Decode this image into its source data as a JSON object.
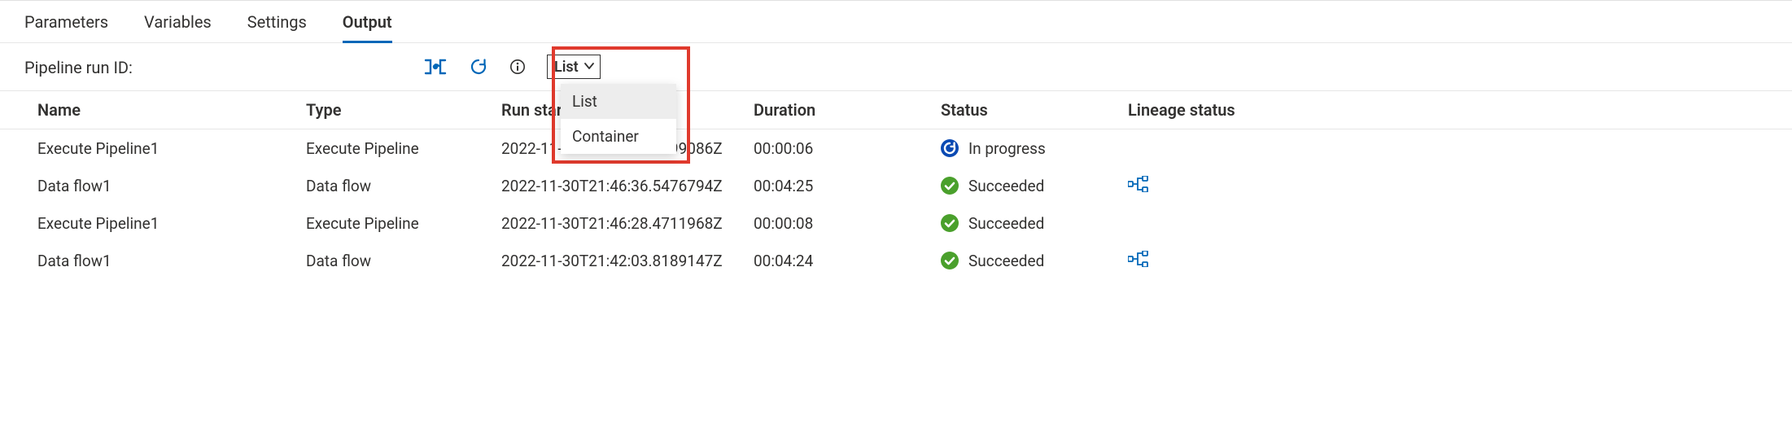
{
  "tabs": {
    "parameters": "Parameters",
    "variables": "Variables",
    "settings": "Settings",
    "output": "Output"
  },
  "toolbar": {
    "run_id_label": "Pipeline run ID:",
    "view_selected": "List",
    "view_options": {
      "list": "List",
      "container": "Container"
    }
  },
  "columns": {
    "name": "Name",
    "type": "Type",
    "run_start": "Run start",
    "duration": "Duration",
    "status": "Status",
    "lineage": "Lineage status"
  },
  "rows": [
    {
      "name": "Execute Pipeline1",
      "type": "Execute Pipeline",
      "run_start": "2022-11-30T21:51:02.5799086Z",
      "duration": "00:00:06",
      "status": "In progress",
      "status_kind": "inprogress",
      "has_lineage": false
    },
    {
      "name": "Data flow1",
      "type": "Data flow",
      "run_start": "2022-11-30T21:46:36.5476794Z",
      "duration": "00:04:25",
      "status": "Succeeded",
      "status_kind": "success",
      "has_lineage": true
    },
    {
      "name": "Execute Pipeline1",
      "type": "Execute Pipeline",
      "run_start": "2022-11-30T21:46:28.4711968Z",
      "duration": "00:00:08",
      "status": "Succeeded",
      "status_kind": "success",
      "has_lineage": false
    },
    {
      "name": "Data flow1",
      "type": "Data flow",
      "run_start": "2022-11-30T21:42:03.8189147Z",
      "duration": "00:04:24",
      "status": "Succeeded",
      "status_kind": "success",
      "has_lineage": true
    }
  ]
}
